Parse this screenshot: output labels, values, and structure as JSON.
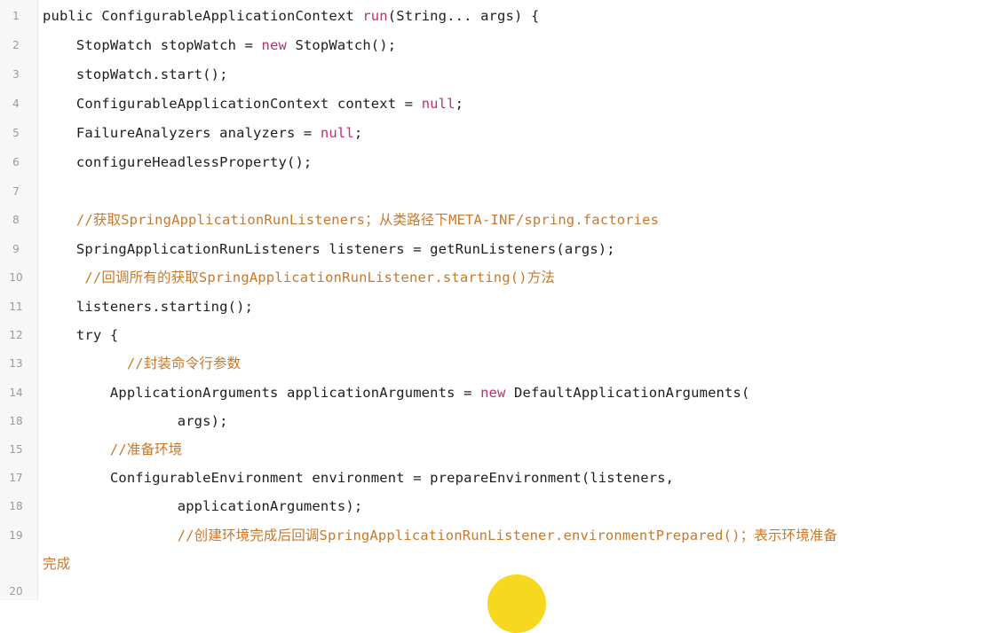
{
  "lines": [
    {
      "n": "1",
      "pre": "public ConfigurableApplicationContext ",
      "hl": "run",
      "post": "(String... args) {"
    },
    {
      "n": "2",
      "pre": "    StopWatch stopWatch = ",
      "hl": "new",
      "post": " StopWatch();"
    },
    {
      "n": "3",
      "pre": "    stopWatch.start();",
      "hl": "",
      "post": ""
    },
    {
      "n": "4",
      "pre": "    ConfigurableApplicationContext context = ",
      "hl": "null",
      "post": ";"
    },
    {
      "n": "5",
      "pre": "    FailureAnalyzers analyzers = ",
      "hl": "null",
      "post": ";"
    },
    {
      "n": "6",
      "pre": "    configureHeadlessProperty();",
      "hl": "",
      "post": ""
    },
    {
      "n": "7",
      "pre": "",
      "hl": "",
      "post": ""
    },
    {
      "n": "8",
      "comment": "    //获取SpringApplicationRunListeners；从类路径下META-INF/spring.factories"
    },
    {
      "n": "9",
      "pre": "    SpringApplicationRunListeners listeners = getRunListeners(args);",
      "hl": "",
      "post": ""
    },
    {
      "n": "10",
      "comment": "     //回调所有的获取SpringApplicationRunListener.starting()方法"
    },
    {
      "n": "11",
      "pre": "    listeners.starting();",
      "hl": "",
      "post": ""
    },
    {
      "n": "12",
      "pre": "    try {",
      "hl": "",
      "post": ""
    },
    {
      "n": "13",
      "comment": "          //封装命令行参数"
    },
    {
      "n": "14",
      "pre": "        ApplicationArguments applicationArguments = ",
      "hl": "new",
      "post": " DefaultApplicationArguments("
    },
    {
      "n": "18",
      "pre": "                args);",
      "hl": "",
      "post": ""
    },
    {
      "n": "15",
      "comment": "        //准备环境"
    },
    {
      "n": "17",
      "pre": "        ConfigurableEnvironment environment = prepareEnvironment(listeners,",
      "hl": "",
      "post": ""
    },
    {
      "n": "18",
      "pre": "                applicationArguments);",
      "hl": "",
      "post": ""
    },
    {
      "n": "19",
      "comment": "                //创建环境完成后回调SpringApplicationRunListener.environmentPrepared()；表示环境准备"
    },
    {
      "n": "",
      "comment": "完成",
      "wrap": true
    },
    {
      "n": "20",
      "pre": "",
      "hl": "",
      "post": ""
    }
  ]
}
